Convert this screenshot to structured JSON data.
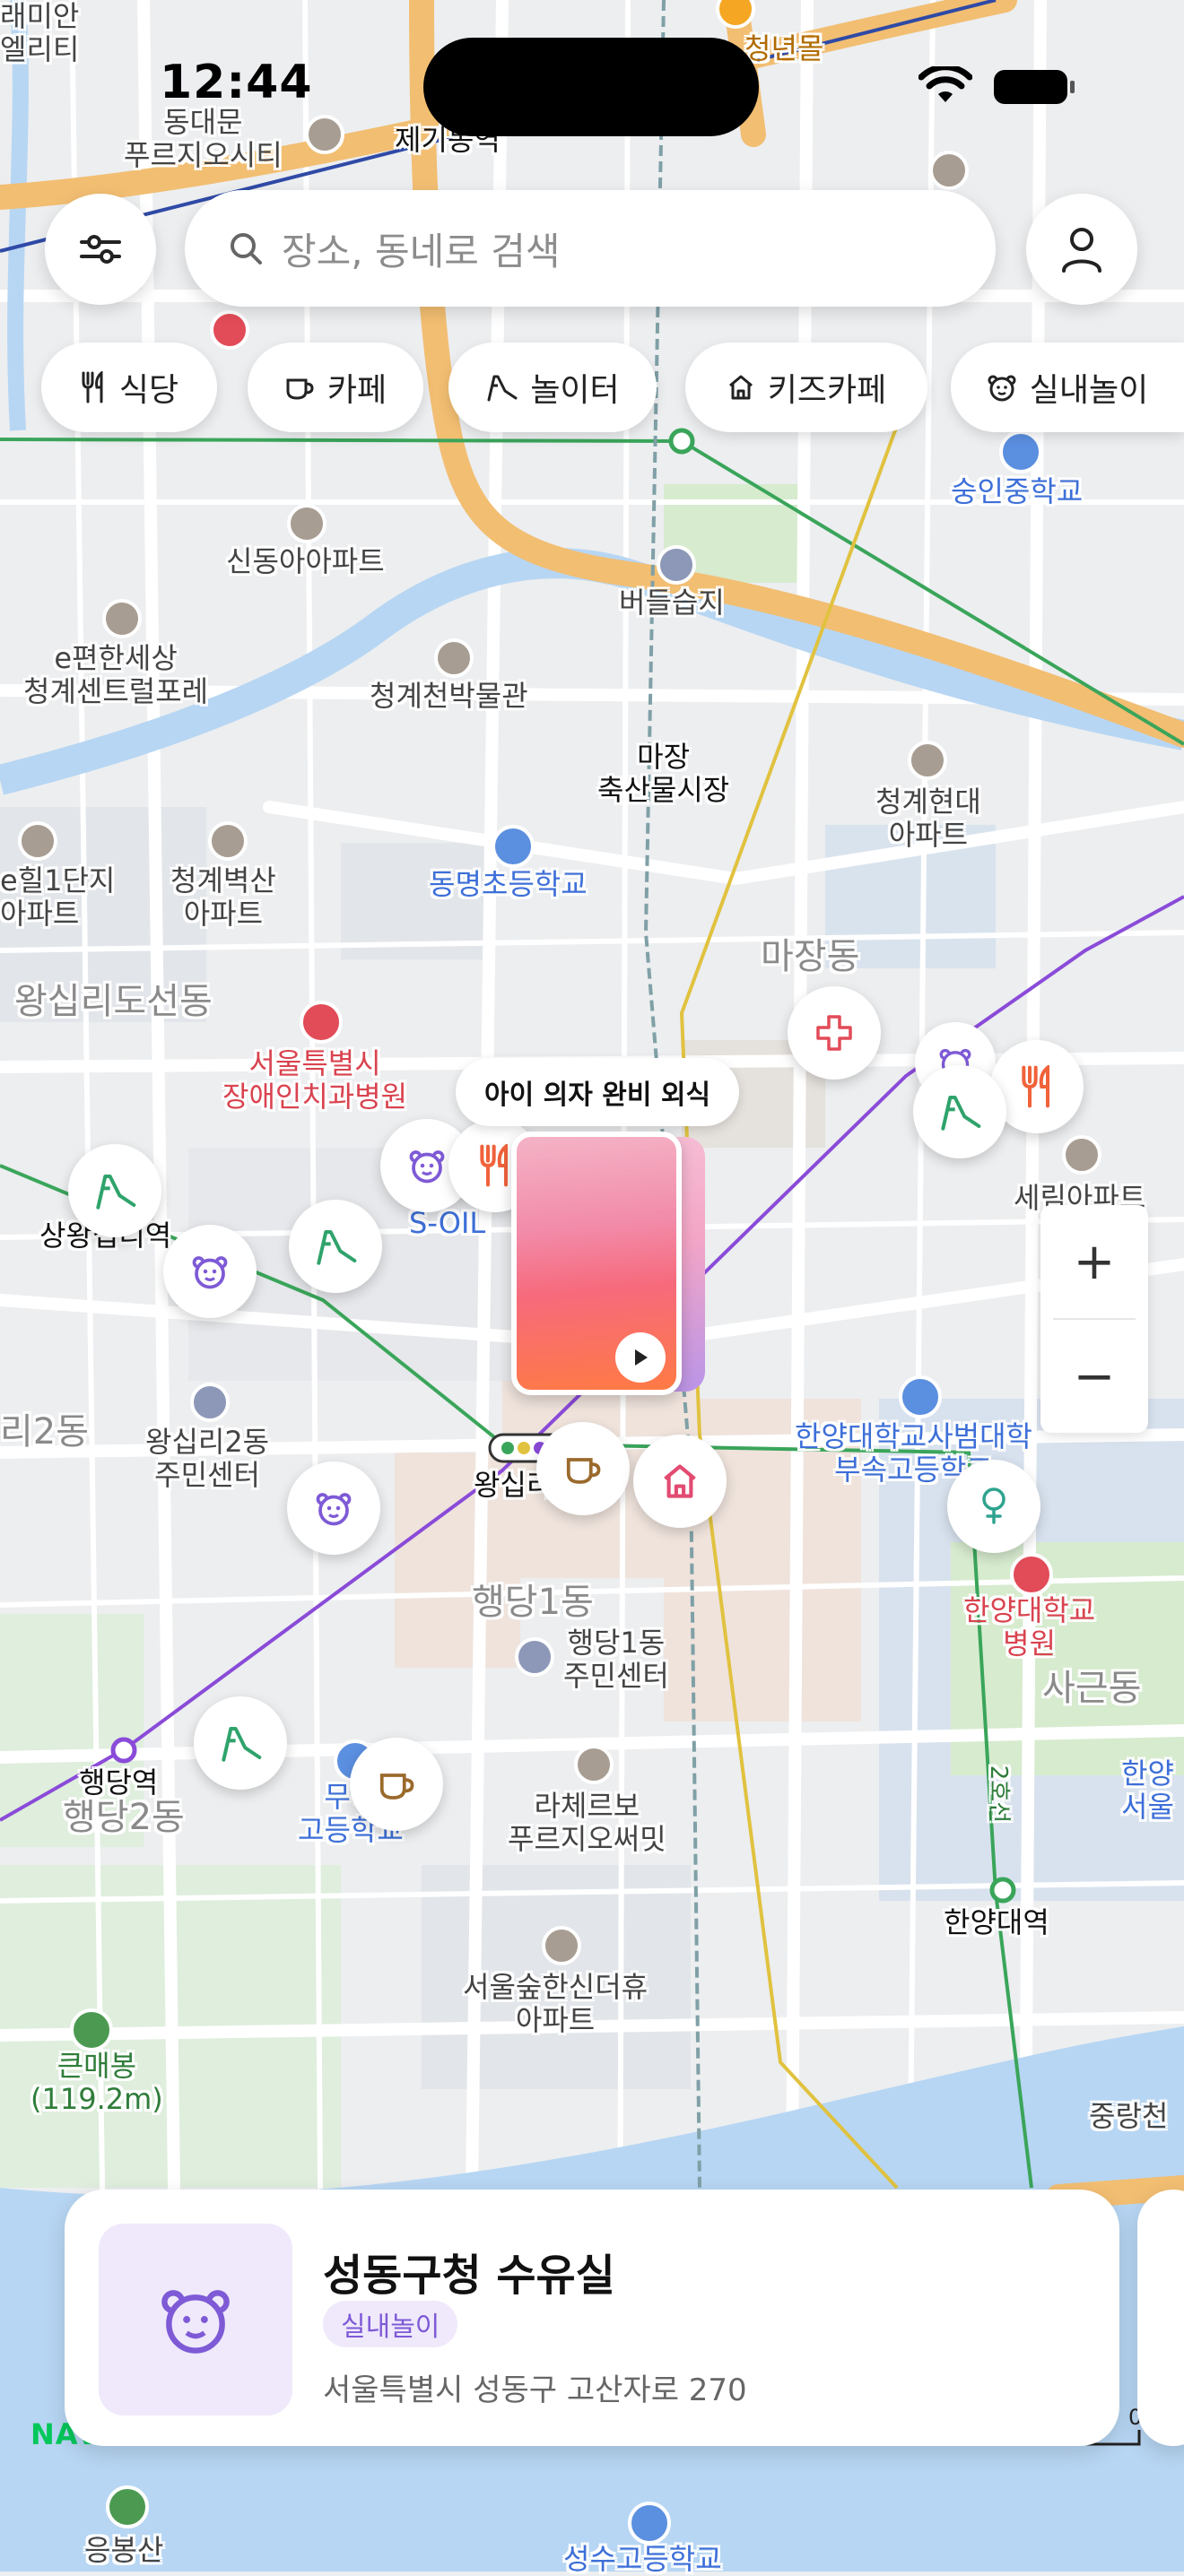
{
  "status_bar": {
    "time": "12:44"
  },
  "search": {
    "placeholder": "장소, 동네로 검색"
  },
  "filters": [
    {
      "label": "식당",
      "icon": "fork-knife-icon"
    },
    {
      "label": "카페",
      "icon": "coffee-cup-icon"
    },
    {
      "label": "놀이터",
      "icon": "slide-icon"
    },
    {
      "label": "키즈카페",
      "icon": "house-icon"
    },
    {
      "label": "실내놀이",
      "icon": "bear-icon"
    }
  ],
  "map": {
    "labels": {
      "remian": "래미안\n엘리티",
      "dongdaemun": "동대문\n푸르지오시티",
      "jegidong": "제기동역",
      "cheongnyeonmol": "청년몰",
      "sindong": "신동아아파트",
      "ebenhan": "e편한세상\n청계센트럴포레",
      "museum": "청계천박물관",
      "beodeul": "버들습지",
      "majang_market": "마장\n축산물시장",
      "cheonggye_hyundai": "청계현대\n아파트",
      "sunginjung": "숭인중학교",
      "dongmyeong": "동명초등학교",
      "byeoksan": "청계벽산\n아파트",
      "hill1": "e힐1단지\n아파트",
      "wangsimni_doseon": "왕십리도선동",
      "majangdong": "마장동",
      "dental": "서울특별시\n장애인치과병원",
      "sangwangsimni": "상왕십리역",
      "soil": "S-OIL",
      "serim": "세림아파트",
      "wangsimni2dong": "리2동",
      "wangsimni2_center": "왕십리2동\n주민센터",
      "wangsimni_station": "왕십리",
      "hanyang_school": "한양대학교사범대학\n부속고등학교",
      "haengdang1": "행당1동",
      "haengdang1_center": "행당1동\n주민센터",
      "hanyang_hospital": "한양대학교\n병원",
      "sageundong": "사근동",
      "haengdang_station": "행당역",
      "haengdang2": "행당2동",
      "muhak": "무학\n고등학교",
      "lachelle": "라체르보\n푸르지오써밋",
      "hanyang_station": "한양대역",
      "line2": "2호선",
      "seoulsup": "서울숲한신더휴\n아파트",
      "keunmaebong": "큰매봉\n(119.2m)",
      "jungnangcheon": "중랑천",
      "eungbongsan": "응봉산",
      "seongsu_school": "성수고등학교",
      "hanyang_seoul": "한양\n서울"
    }
  },
  "featured": {
    "tooltip": "아이 의자 완비 외식"
  },
  "zoom": {
    "in": "+",
    "out": "−"
  },
  "place_card": {
    "name": "성동구청 수유실",
    "category": "실내놀이",
    "address": "서울특별시 성동구 고산자로 270"
  },
  "naver_logo": "NAVER",
  "scale_label": "0",
  "colors": {
    "accent": "#7e5ad6",
    "restaurant": "#f0623a",
    "cafe": "#9a6a2c",
    "playground": "#2fa36b",
    "kidscafe": "#e24b72",
    "indoor": "#7e5ad6",
    "hospital": "#e24b58"
  }
}
